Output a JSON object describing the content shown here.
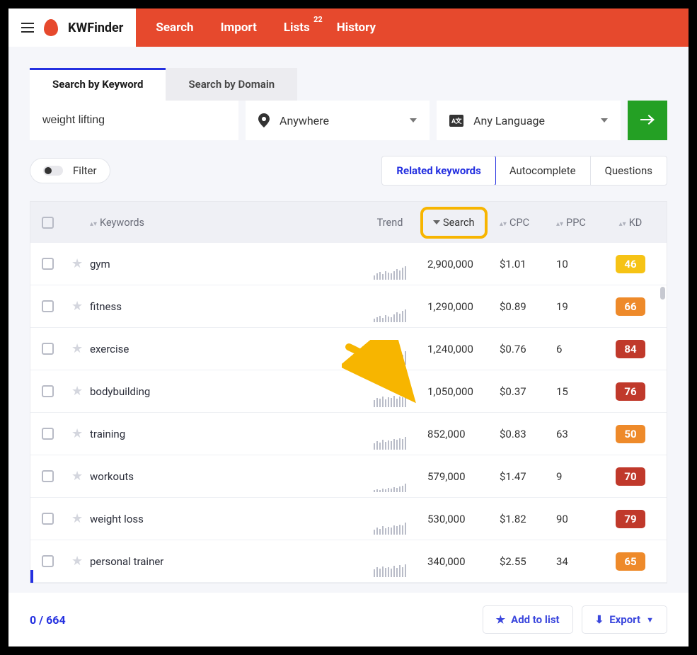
{
  "brand": "KWFinder",
  "nav": {
    "search": "Search",
    "import": "Import",
    "lists": "Lists",
    "lists_badge": "22",
    "history": "History"
  },
  "tabs": {
    "by_keyword": "Search by Keyword",
    "by_domain": "Search by Domain"
  },
  "search": {
    "value": "weight lifting",
    "location": "Anywhere",
    "language": "Any Language"
  },
  "filter_label": "Filter",
  "view_tabs": {
    "related": "Related keywords",
    "autocomplete": "Autocomplete",
    "questions": "Questions"
  },
  "columns": {
    "keywords": "Keywords",
    "trend": "Trend",
    "search": "Search",
    "cpc": "CPC",
    "ppc": "PPC",
    "kd": "KD"
  },
  "rows": [
    {
      "keyword": "gym",
      "search": "2,900,000",
      "cpc": "$1.01",
      "ppc": "10",
      "kd": "46",
      "kd_color": "#f6c315",
      "trend": [
        6,
        9,
        11,
        8,
        12,
        10,
        9,
        12,
        15,
        13,
        17,
        19
      ]
    },
    {
      "keyword": "fitness",
      "search": "1,290,000",
      "cpc": "$0.89",
      "ppc": "19",
      "kd": "66",
      "kd_color": "#ee8a2a",
      "trend": [
        5,
        7,
        9,
        6,
        10,
        8,
        7,
        11,
        14,
        12,
        16,
        18
      ]
    },
    {
      "keyword": "exercise",
      "search": "1,240,000",
      "cpc": "$0.76",
      "ppc": "6",
      "kd": "84",
      "kd_color": "#c0392b",
      "trend": [
        4,
        8,
        6,
        10,
        7,
        9,
        11,
        8,
        13,
        15,
        14,
        19
      ]
    },
    {
      "keyword": "bodybuilding",
      "search": "1,050,000",
      "cpc": "$0.37",
      "ppc": "15",
      "kd": "76",
      "kd_color": "#c0392b",
      "trend": [
        10,
        13,
        12,
        15,
        11,
        14,
        13,
        16,
        12,
        15,
        14,
        17
      ]
    },
    {
      "keyword": "training",
      "search": "852,000",
      "cpc": "$0.83",
      "ppc": "63",
      "kd": "50",
      "kd_color": "#ee8a2a",
      "trend": [
        9,
        12,
        10,
        14,
        11,
        13,
        12,
        15,
        14,
        16,
        15,
        18
      ]
    },
    {
      "keyword": "workouts",
      "search": "579,000",
      "cpc": "$1.47",
      "ppc": "9",
      "kd": "70",
      "kd_color": "#c0392b",
      "trend": [
        3,
        4,
        3,
        5,
        4,
        6,
        5,
        7,
        6,
        8,
        9,
        12
      ]
    },
    {
      "keyword": "weight loss",
      "search": "530,000",
      "cpc": "$1.82",
      "ppc": "90",
      "kd": "79",
      "kd_color": "#c0392b",
      "trend": [
        7,
        10,
        8,
        12,
        9,
        11,
        10,
        13,
        12,
        14,
        13,
        17
      ]
    },
    {
      "keyword": "personal trainer",
      "search": "340,000",
      "cpc": "$2.55",
      "ppc": "34",
      "kd": "65",
      "kd_color": "#ee8a2a",
      "trend": [
        11,
        14,
        12,
        15,
        13,
        14,
        12,
        16,
        13,
        17,
        14,
        18
      ]
    }
  ],
  "footer": {
    "selected": "0",
    "sep": " / ",
    "total": "664",
    "add_to_list": "Add to list",
    "export": "Export"
  }
}
